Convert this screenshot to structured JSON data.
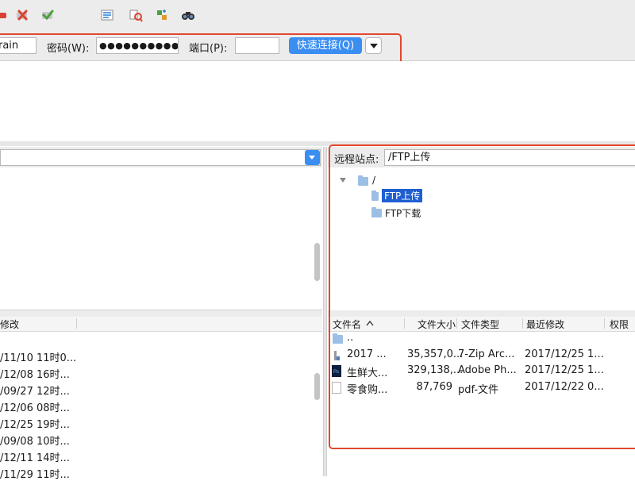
{
  "toolbar": {
    "icons": [
      "disconnect-icon",
      "cancel-icon",
      "reconnect-icon",
      "filter-icon",
      "compare-icon",
      "sync-browse-icon",
      "search-icon"
    ]
  },
  "quickconnect": {
    "user_value": "rain",
    "password_label": "密码(W):",
    "password_value": "●●●●●●●●●●●●",
    "port_label": "端口(P):",
    "port_value": "",
    "connect_label": "快速连接(Q)"
  },
  "local": {
    "col_modified": "修改",
    "dates": [
      "/11/10 11时0...",
      "/12/08 16时...",
      "/09/27 12时...",
      "/12/06 08时...",
      "/12/25 19时...",
      "/09/08 10时...",
      "/12/11 14时...",
      "/11/29 11时..."
    ]
  },
  "remote": {
    "site_label": "远程站点:",
    "site_path": "/FTP上传",
    "tree": {
      "root": "/",
      "children": [
        "FTP上传",
        "FTP下载"
      ],
      "selected": "FTP上传"
    },
    "columns": {
      "name": "文件名",
      "size": "文件大小",
      "type": "文件类型",
      "modified": "最近修改",
      "perms": "权限"
    },
    "files": [
      {
        "name": "..",
        "size": "",
        "type": "",
        "modified": "",
        "icon": "folder-icon"
      },
      {
        "name": "2017 ...",
        "size": "35,357,0...",
        "type": "7-Zip Arc...",
        "modified": "2017/12/25 1...",
        "icon": "archive-icon"
      },
      {
        "name": "生鲜大...",
        "size": "329,138,...",
        "type": "Adobe Ph...",
        "modified": "2017/12/25 1...",
        "icon": "photoshop-icon"
      },
      {
        "name": "零食购...",
        "size": "87,769",
        "type": "pdf-文件",
        "modified": "2017/12/22 0...",
        "icon": "pdf-icon"
      }
    ]
  }
}
